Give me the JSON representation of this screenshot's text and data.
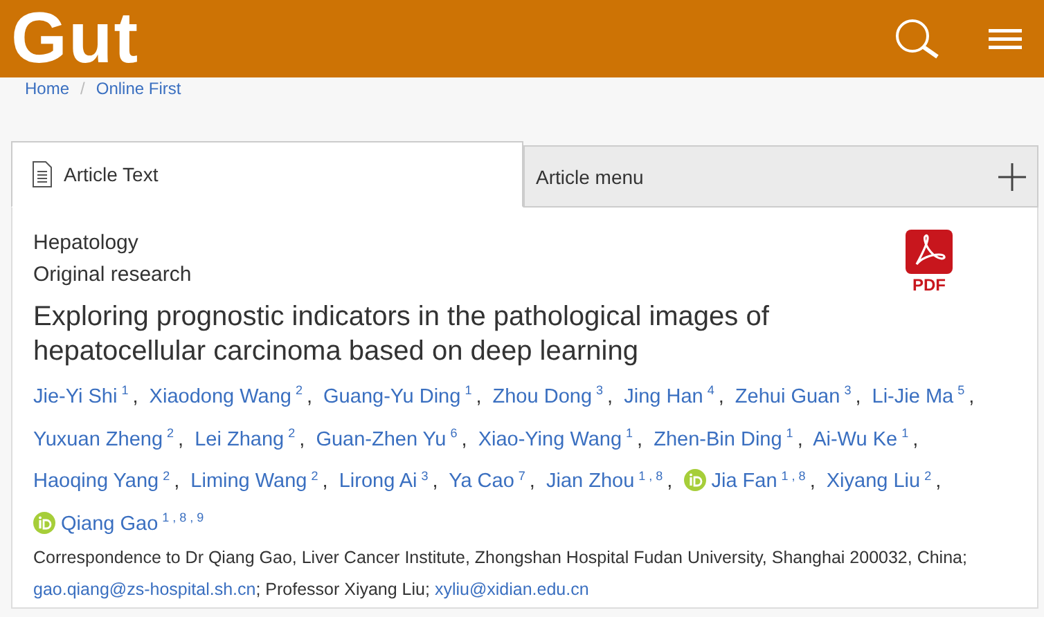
{
  "header": {
    "logo": "Gut"
  },
  "breadcrumb": [
    {
      "label": "Home"
    },
    {
      "label": "Online First"
    }
  ],
  "breadcrumb_separator": "/",
  "tabs": [
    {
      "label": "Article Text",
      "selected": true
    },
    {
      "label": "Article menu",
      "selected": false
    }
  ],
  "article": {
    "section": "Hepatology",
    "type": "Original research",
    "pdf_label": "PDF",
    "title": "Exploring prognostic indicators in the pathological images of hepatocellular carcinoma based on deep learning",
    "authors": [
      {
        "name": "Jie-Yi Shi",
        "sup": "1",
        "trail": ","
      },
      {
        "name": "Xiaodong Wang",
        "sup": "2",
        "trail": ","
      },
      {
        "name": "Guang-Yu Ding",
        "sup": "1",
        "trail": ","
      },
      {
        "name": "Zhou Dong",
        "sup": "3",
        "trail": ","
      },
      {
        "name": "Jing Han",
        "sup": "4",
        "trail": ","
      },
      {
        "name": "Zehui Guan",
        "sup": "3",
        "trail": ","
      },
      {
        "name": "Li-Jie Ma",
        "sup": "5",
        "trail": ","
      },
      {
        "name": "Yuxuan Zheng",
        "sup": "2",
        "trail": ","
      },
      {
        "name": "Lei Zhang",
        "sup": "2",
        "trail": ","
      },
      {
        "name": "Guan-Zhen Yu",
        "sup": "6",
        "trail": ","
      },
      {
        "name": "Xiao-Ying Wang",
        "sup": "1",
        "trail": ","
      },
      {
        "name": "Zhen-Bin Ding",
        "sup": "1",
        "trail": ","
      },
      {
        "name": "Ai-Wu Ke",
        "sup": "1",
        "trail": ","
      },
      {
        "name": "Haoqing Yang",
        "sup": "2",
        "trail": ","
      },
      {
        "name": "Liming Wang",
        "sup": "2",
        "trail": ","
      },
      {
        "name": "Lirong Ai",
        "sup": "3",
        "trail": ","
      },
      {
        "name": "Ya Cao",
        "sup": "7",
        "trail": ","
      },
      {
        "name": "Jian Zhou",
        "sup": "1 , 8",
        "trail": ","
      },
      {
        "name": "Jia Fan",
        "sup": "1 , 8",
        "trail": ",",
        "orcid": true
      },
      {
        "name": "Xiyang Liu",
        "sup": "2",
        "trail": ","
      },
      {
        "name": "Qiang Gao",
        "sup": "1 , 8 , 9",
        "orcid": true
      }
    ],
    "correspondence": [
      {
        "kind": "text",
        "text": "Correspondence to Dr Qiang Gao, Liver Cancer Institute, Zhongshan Hospital Fudan University, Shanghai 200032, China; "
      },
      {
        "kind": "link",
        "text": "gao.qiang@zs-hospital.sh.cn"
      },
      {
        "kind": "text",
        "text": "; Professor Xiyang Liu; "
      },
      {
        "kind": "link",
        "text": "xyliu@xidian.edu.cn"
      }
    ]
  }
}
